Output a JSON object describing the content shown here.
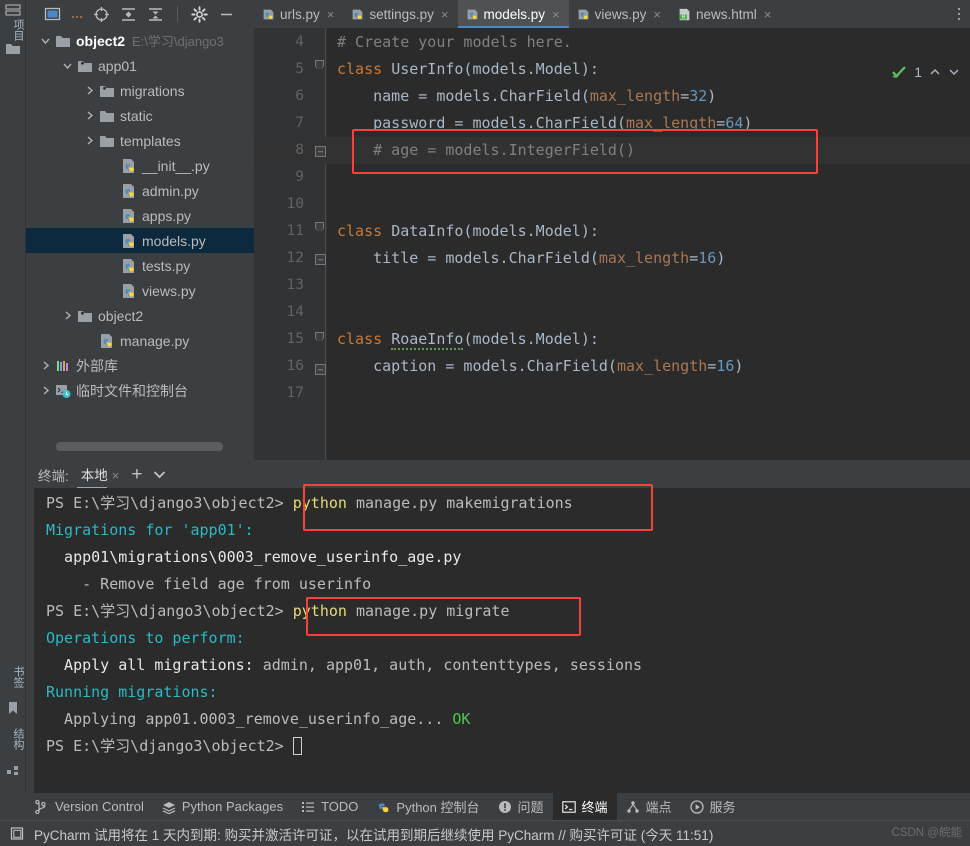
{
  "toolbar": {
    "icons": [
      {
        "name": "project-widget-icon",
        "glyph": "window"
      },
      {
        "name": "more-options-icon",
        "glyph": "ellipsis"
      },
      {
        "name": "locate-target-icon",
        "glyph": "crosshair"
      },
      {
        "name": "expand-all-icon",
        "glyph": "expand"
      },
      {
        "name": "collapse-all-icon",
        "glyph": "collapse"
      },
      {
        "name": "settings-gear-icon",
        "glyph": "gear"
      },
      {
        "name": "hide-panel-icon",
        "glyph": "minus"
      }
    ]
  },
  "left_strip": {
    "project_label": "项目",
    "bookmarks_label": "书签",
    "structure_label": "结构"
  },
  "tabs": [
    {
      "label": "urls.py",
      "icon": "python-file-icon",
      "active": false,
      "close": "×"
    },
    {
      "label": "settings.py",
      "icon": "python-file-icon",
      "active": false,
      "close": "×"
    },
    {
      "label": "models.py",
      "icon": "python-file-icon",
      "active": true,
      "close": "×"
    },
    {
      "label": "views.py",
      "icon": "python-file-icon",
      "active": false,
      "close": "×"
    },
    {
      "label": "news.html",
      "icon": "html-file-icon",
      "active": false,
      "close": "×"
    }
  ],
  "project_tree": [
    {
      "label": "object2",
      "path": "E:\\学习\\django3",
      "icon": "folder-icon",
      "arrow": "down",
      "indent": 14,
      "bold": true,
      "selected": false
    },
    {
      "label": "app01",
      "path": "",
      "icon": "module-folder-icon",
      "arrow": "down",
      "indent": 36,
      "bold": false,
      "selected": false
    },
    {
      "label": "migrations",
      "path": "",
      "icon": "module-folder-icon",
      "arrow": "right",
      "indent": 58,
      "bold": false,
      "selected": false
    },
    {
      "label": "static",
      "path": "",
      "icon": "folder-icon",
      "arrow": "right",
      "indent": 58,
      "bold": false,
      "selected": false
    },
    {
      "label": "templates",
      "path": "",
      "icon": "folder-icon",
      "arrow": "right",
      "indent": 58,
      "bold": false,
      "selected": false
    },
    {
      "label": "__init__.py",
      "path": "",
      "icon": "python-file-icon",
      "arrow": "none",
      "indent": 80,
      "bold": false,
      "selected": false
    },
    {
      "label": "admin.py",
      "path": "",
      "icon": "python-file-icon",
      "arrow": "none",
      "indent": 80,
      "bold": false,
      "selected": false
    },
    {
      "label": "apps.py",
      "path": "",
      "icon": "python-file-icon",
      "arrow": "none",
      "indent": 80,
      "bold": false,
      "selected": false
    },
    {
      "label": "models.py",
      "path": "",
      "icon": "python-file-icon",
      "arrow": "none",
      "indent": 80,
      "bold": false,
      "selected": true
    },
    {
      "label": "tests.py",
      "path": "",
      "icon": "python-file-icon",
      "arrow": "none",
      "indent": 80,
      "bold": false,
      "selected": false
    },
    {
      "label": "views.py",
      "path": "",
      "icon": "python-file-icon",
      "arrow": "none",
      "indent": 80,
      "bold": false,
      "selected": false
    },
    {
      "label": "object2",
      "path": "",
      "icon": "module-folder-icon",
      "arrow": "right",
      "indent": 36,
      "bold": false,
      "selected": false
    },
    {
      "label": "manage.py",
      "path": "",
      "icon": "python-file-icon",
      "arrow": "none",
      "indent": 58,
      "bold": false,
      "selected": false
    },
    {
      "label": "外部库",
      "path": "",
      "icon": "library-icon",
      "arrow": "right",
      "indent": 14,
      "bold": false,
      "selected": false
    },
    {
      "label": "临时文件和控制台",
      "path": "",
      "icon": "scratch-icon",
      "arrow": "right",
      "indent": 14,
      "bold": false,
      "selected": false
    }
  ],
  "editor": {
    "inspection_count": "1",
    "inspection_icon": "inspections-ok-icon",
    "lines": [
      {
        "no": "4",
        "segments": [
          {
            "t": "# Create your models here.",
            "c": "cmt"
          }
        ]
      },
      {
        "no": "5",
        "segments": [
          {
            "t": "class ",
            "c": "k"
          },
          {
            "t": "UserInfo(models.Model):",
            "c": ""
          }
        ]
      },
      {
        "no": "6",
        "segments": [
          {
            "t": "    name = models.CharField(",
            "c": ""
          },
          {
            "t": "max_length",
            "c": "kw-arg"
          },
          {
            "t": "=",
            "c": ""
          },
          {
            "t": "32",
            "c": "num"
          },
          {
            "t": ")",
            "c": ""
          }
        ]
      },
      {
        "no": "7",
        "segments": [
          {
            "t": "    password = models.CharField(",
            "c": ""
          },
          {
            "t": "max_length",
            "c": "kw-arg"
          },
          {
            "t": "=",
            "c": ""
          },
          {
            "t": "64",
            "c": "num"
          },
          {
            "t": ")",
            "c": ""
          }
        ]
      },
      {
        "no": "8",
        "segments": [
          {
            "t": "    # age = models.IntegerField()",
            "c": "cmt"
          }
        ]
      },
      {
        "no": "9",
        "segments": []
      },
      {
        "no": "10",
        "segments": []
      },
      {
        "no": "11",
        "segments": [
          {
            "t": "class ",
            "c": "k"
          },
          {
            "t": "DataInfo(models.Model):",
            "c": ""
          }
        ]
      },
      {
        "no": "12",
        "segments": [
          {
            "t": "    title = models.CharField(",
            "c": ""
          },
          {
            "t": "max_length",
            "c": "kw-arg"
          },
          {
            "t": "=",
            "c": ""
          },
          {
            "t": "16",
            "c": "num"
          },
          {
            "t": ")",
            "c": ""
          }
        ]
      },
      {
        "no": "13",
        "segments": []
      },
      {
        "no": "14",
        "segments": []
      },
      {
        "no": "15",
        "segments": [
          {
            "t": "class ",
            "c": "k"
          },
          {
            "t": "RoaeInfo",
            "c": "typo"
          },
          {
            "t": "(models.Model):",
            "c": ""
          }
        ]
      },
      {
        "no": "16",
        "segments": [
          {
            "t": "    caption = models.CharField(",
            "c": ""
          },
          {
            "t": "max_length",
            "c": "kw-arg"
          },
          {
            "t": "=",
            "c": ""
          },
          {
            "t": "16",
            "c": "num"
          },
          {
            "t": ")",
            "c": ""
          }
        ]
      },
      {
        "no": "17",
        "segments": []
      }
    ]
  },
  "terminal": {
    "title": "终端:",
    "tab_label": "本地",
    "tab_close": "×",
    "add_label": "+",
    "dropdown_icon": "chevron-down-icon",
    "lines": [
      {
        "segments": [
          {
            "t": "PS E:\\学习\\django3\\object2> ",
            "c": "t-grey"
          },
          {
            "t": "python ",
            "c": "t-yellow"
          },
          {
            "t": "manage.py makemigrations",
            "c": "t-grey"
          }
        ]
      },
      {
        "segments": [
          {
            "t": "Migrations for 'app01':",
            "c": "t-cyan"
          }
        ]
      },
      {
        "segments": [
          {
            "t": "  app01\\migrations\\0003_remove_userinfo_age.py",
            "c": "t-white"
          }
        ]
      },
      {
        "segments": [
          {
            "t": "    - Remove field age from userinfo",
            "c": "t-grey"
          }
        ]
      },
      {
        "segments": [
          {
            "t": "PS E:\\学习\\django3\\object2> ",
            "c": "t-grey"
          },
          {
            "t": "python ",
            "c": "t-yellow"
          },
          {
            "t": "manage.py migrate",
            "c": "t-grey"
          }
        ]
      },
      {
        "segments": [
          {
            "t": "Operations to perform:",
            "c": "t-cyan"
          }
        ]
      },
      {
        "segments": [
          {
            "t": "  Apply all migrations: ",
            "c": "t-white"
          },
          {
            "t": "admin, app01, auth, contenttypes, sessions",
            "c": "t-grey"
          }
        ]
      },
      {
        "segments": [
          {
            "t": "Running migrations:",
            "c": "t-cyan"
          }
        ]
      },
      {
        "segments": [
          {
            "t": "  Applying app01.0003_remove_userinfo_age... ",
            "c": "t-grey"
          },
          {
            "t": "OK",
            "c": "t-green"
          }
        ]
      },
      {
        "segments": [
          {
            "t": "PS E:\\学习\\django3\\object2> ",
            "c": "t-grey"
          }
        ],
        "cursor": true
      }
    ]
  },
  "statusbar": [
    {
      "label": "Version Control",
      "icon": "branch-icon",
      "active": false
    },
    {
      "label": "Python Packages",
      "icon": "packages-icon",
      "active": false
    },
    {
      "label": "TODO",
      "icon": "todo-list-icon",
      "active": false
    },
    {
      "label": "Python 控制台",
      "icon": "python-console-icon",
      "active": false
    },
    {
      "label": "问题",
      "icon": "problems-icon",
      "active": false
    },
    {
      "label": "终端",
      "icon": "terminal-icon",
      "active": true
    },
    {
      "label": "端点",
      "icon": "endpoints-icon",
      "active": false
    },
    {
      "label": "服务",
      "icon": "services-icon",
      "active": false
    }
  ],
  "notification": {
    "icon": "license-notice-icon",
    "text": "PyCharm 试用将在 1 天内到期: 购买并激活许可证，以在试用到期后继续使用 PyCharm // 购买许可证 (今天 11:51)"
  },
  "watermark": "CSDN @皖能",
  "colors": {
    "accent": "#4a88c7",
    "annotation": "#f4433a",
    "keyword": "#cc7832",
    "number": "#6897bb",
    "comment": "#808080",
    "terminal_cyan": "#2bbac5",
    "terminal_green": "#4ec94e",
    "selection": "#0d293e"
  }
}
